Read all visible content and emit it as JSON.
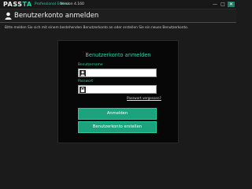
{
  "app": {
    "brand_main": "PASS",
    "brand_accent": "TA",
    "edition": "Professional Edition",
    "version": "Version 4.160"
  },
  "window_controls": {
    "minimize": "—",
    "maximize": "□",
    "close": "✕"
  },
  "header": {
    "title": "Benutzerkonto anmelden",
    "icon": "user-icon"
  },
  "info_text": "Bitte melden Sie sich mit einem bestehenden Benutzerkonto an oder erstellen Sie ein neues Benutzerkonto.",
  "login": {
    "title": "Benutzerkonto anmelden",
    "username_label": "Benutzername",
    "username_value": "",
    "password_label": "Passwort",
    "password_value": "",
    "forgot_link": "Passwort vergessen?",
    "login_button": "Anmelden",
    "create_button": "Benutzerkonto erstellen"
  },
  "colors": {
    "accent": "#2fd0a9",
    "button": "#1aa37d",
    "background": "#1b1b1b",
    "panel": "#070707"
  }
}
